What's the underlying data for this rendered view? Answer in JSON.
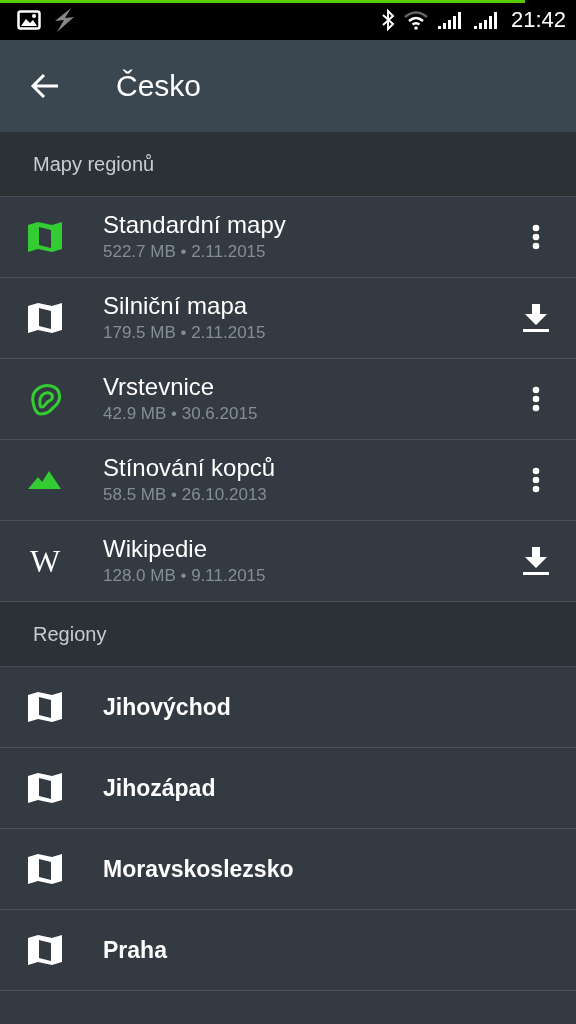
{
  "status_bar": {
    "time": "21:42"
  },
  "toolbar": {
    "title": "Česko"
  },
  "sections": [
    {
      "title": "Mapy regionů",
      "items": [
        {
          "kind": "map",
          "title": "Standardní mapy",
          "subtitle": "522.7 MB • 2.11.2015",
          "downloaded": true
        },
        {
          "kind": "map",
          "title": "Silniční mapa",
          "subtitle": "179.5 MB • 2.11.2015",
          "downloaded": false
        },
        {
          "kind": "contour",
          "title": "Vrstevnice",
          "subtitle": "42.9 MB • 30.6.2015",
          "downloaded": true
        },
        {
          "kind": "hillshade",
          "title": "Stínování kopců",
          "subtitle": "58.5 MB • 26.10.2013",
          "downloaded": true
        },
        {
          "kind": "wiki",
          "glyph": "W",
          "title": "Wikipedie",
          "subtitle": "128.0 MB • 9.11.2015",
          "downloaded": false
        }
      ]
    },
    {
      "title": "Regiony",
      "items": [
        {
          "kind": "map",
          "title": "Jihovýchod"
        },
        {
          "kind": "map",
          "title": "Jihozápad"
        },
        {
          "kind": "map",
          "title": "Moravskoslezsko"
        },
        {
          "kind": "map",
          "title": "Praha"
        }
      ]
    }
  ]
}
